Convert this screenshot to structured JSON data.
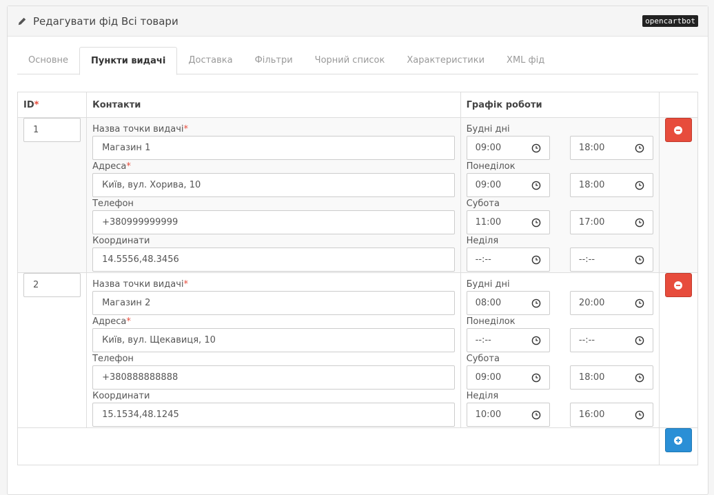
{
  "header": {
    "title": "Редагувати фід Всі товари",
    "badge": "opencartbot"
  },
  "tabs": [
    {
      "label": "Основне",
      "active": false
    },
    {
      "label": "Пункти видачі",
      "active": true
    },
    {
      "label": "Доставка",
      "active": false
    },
    {
      "label": "Фільтри",
      "active": false
    },
    {
      "label": "Чорний список",
      "active": false
    },
    {
      "label": "Характеристики",
      "active": false
    },
    {
      "label": "XML фід",
      "active": false
    }
  ],
  "table": {
    "headers": {
      "id": "ID",
      "required_mark": "*",
      "contacts": "Контакти",
      "schedule": "Графік роботи"
    },
    "labels": {
      "name": "Назва точки видачі",
      "address": "Адреса",
      "phone": "Телефон",
      "coords": "Координати",
      "weekdays": "Будні дні",
      "monday": "Понеділок",
      "saturday": "Субота",
      "sunday": "Неділя"
    },
    "rows": [
      {
        "id": "1",
        "name": "Магазин 1",
        "address": "Київ, вул. Хорива, 10",
        "phone": "+380999999999",
        "coords": "14.5556,48.3456",
        "weekdays": [
          "09:00",
          "18:00"
        ],
        "monday": [
          "09:00",
          "18:00"
        ],
        "saturday": [
          "11:00",
          "17:00"
        ],
        "sunday": [
          "--:--",
          "--:--"
        ]
      },
      {
        "id": "2",
        "name": "Магазин 2",
        "address": "Київ, вул. Щекавиця, 10",
        "phone": "+380888888888",
        "coords": "15.1534,48.1245",
        "weekdays": [
          "08:00",
          "20:00"
        ],
        "monday": [
          "--:--",
          "--:--"
        ],
        "saturday": [
          "09:00",
          "18:00"
        ],
        "sunday": [
          "10:00",
          "16:00"
        ]
      }
    ]
  },
  "colors": {
    "danger": "#e74c3c",
    "primary": "#2a8fd6",
    "required": "#e74c3c"
  },
  "icons": {
    "title": "pencil-icon",
    "time": "clock-icon",
    "remove": "minus-circle-icon",
    "add": "plus-circle-icon"
  }
}
